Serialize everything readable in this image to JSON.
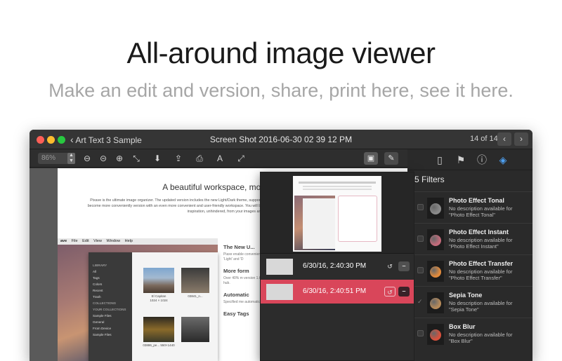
{
  "hero": {
    "headline": "All-around image viewer",
    "subline": "Make an edit and version, share, print here, see it here."
  },
  "window": {
    "back_label": "Art Text 3 Sample",
    "title": "Screen Shot 2016-06-30 02 39 12 PM",
    "counter": "14 of 14",
    "traffic_lights": [
      "#fd5f57",
      "#febc2e",
      "#28c840"
    ]
  },
  "toolbar": {
    "zoom_value": "86%"
  },
  "document": {
    "heading": "A beautiful workspace, more powerful",
    "paragraph": "Pixave is the ultimate image organizer. The updated version includes the new Light/Dark theme, supporting auto-import, while the Smart Collection and System Collection has become more conveniently version with an even more convenient and user-friendly workspace. You will be amazed at how useful workspace lays the groundwork for you to draw inspiration, unhindered, from your images and beautiful.",
    "mini_app": {
      "menu": [
        "ave",
        "File",
        "Edit",
        "View",
        "Window",
        "Help"
      ],
      "sidebar": [
        "LIBRARY",
        "All",
        "Tags",
        "Colors",
        "Recent",
        "Trash",
        "COLLECTIONS",
        "YOUR COLLECTIONS",
        "Sample Files",
        "General",
        "From Device",
        "Sample Files"
      ],
      "thumbs": [
        {
          "caption": "El Capitan\n1024 × 1024"
        },
        {
          "caption": "03841_n..."
        },
        {
          "caption": "03886_pe... 550×1440"
        }
      ]
    },
    "features": [
      "The New U...",
      "Piaxe enable conveniently 'Light' and 'D",
      "More form",
      "Over 40% m version 1.6, hub.",
      "Automatic",
      "Specified me automatic",
      "Easy Tags"
    ]
  },
  "versions_popover": {
    "versions": [
      {
        "date": "6/30/16, 2:40:30 PM",
        "selected": false
      },
      {
        "date": "6/30/16, 2:40:51 PM",
        "selected": true
      }
    ],
    "selected_color": "#d9465a"
  },
  "filters": {
    "title": "5 Filters",
    "items": [
      {
        "name": "Photo Effect Tonal",
        "desc1": "No description available for",
        "desc2": "\"Photo Effect Tonal\"",
        "apple": "#8a8a8a",
        "checked": false
      },
      {
        "name": "Photo Effect Instant",
        "desc1": "No description available for",
        "desc2": "\"Photo Effect Instant\"",
        "apple": "#c36a7a",
        "checked": false
      },
      {
        "name": "Photo Effect Transfer",
        "desc1": "No description available for",
        "desc2": "\"Photo Effect Transfer\"",
        "apple": "#e08a3c",
        "checked": false
      },
      {
        "name": "Sepia Tone",
        "desc1": "No description available for",
        "desc2": "\"Sepia Tone\"",
        "apple": "#b68a5a",
        "checked": true
      },
      {
        "name": "Box Blur",
        "desc1": "No description available for",
        "desc2": "\"Box Blur\"",
        "apple": "#d8503c",
        "checked": false
      }
    ]
  }
}
